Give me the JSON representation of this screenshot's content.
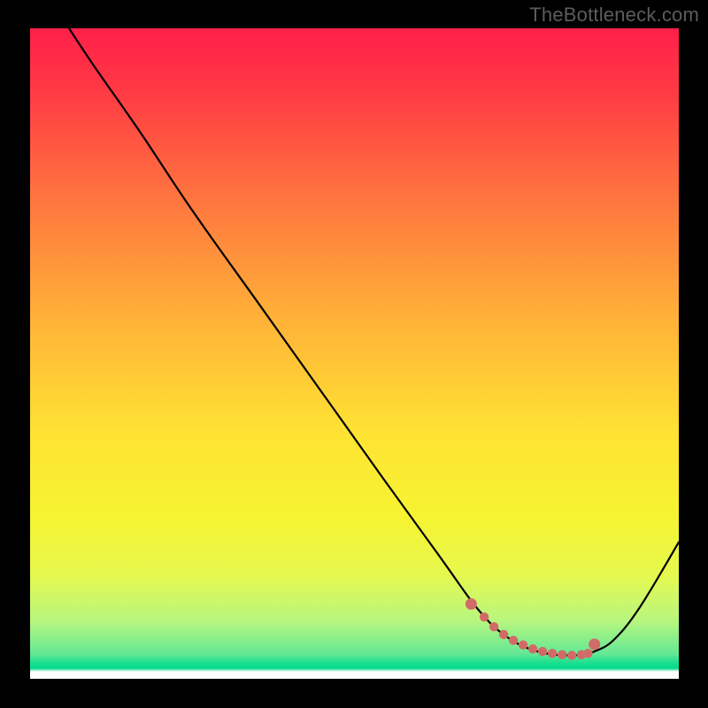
{
  "watermark": "TheBottleneck.com",
  "chart_data": {
    "type": "line",
    "title": "",
    "xlabel": "",
    "ylabel": "",
    "xlim": [
      0,
      100
    ],
    "ylim": [
      0,
      100
    ],
    "grid": false,
    "series": [
      {
        "name": "bottleneck-curve",
        "x": [
          6,
          10,
          17,
          25,
          35,
          45,
          55,
          63,
          68,
          71,
          73,
          75,
          77,
          79,
          81,
          83,
          85,
          87,
          90,
          94,
          100
        ],
        "y": [
          100,
          94,
          84,
          72,
          58,
          44,
          30,
          19,
          12,
          8.5,
          6.8,
          5.5,
          4.6,
          4.0,
          3.7,
          3.6,
          3.7,
          4.2,
          6.0,
          11,
          21
        ]
      }
    ],
    "markers": {
      "name": "highlight-dots",
      "x": [
        68,
        70,
        71.5,
        73,
        74.5,
        76,
        77.5,
        79,
        80.5,
        82,
        83.5,
        85,
        86,
        87
      ],
      "y": [
        11.5,
        9.5,
        8.0,
        6.8,
        5.9,
        5.2,
        4.6,
        4.2,
        3.9,
        3.7,
        3.6,
        3.7,
        3.9,
        5.3
      ]
    },
    "gradient_stops": [
      {
        "pos": 0,
        "color": "#ff1f49"
      },
      {
        "pos": 0.1,
        "color": "#ff3b44"
      },
      {
        "pos": 0.25,
        "color": "#ff713f"
      },
      {
        "pos": 0.45,
        "color": "#ffb338"
      },
      {
        "pos": 0.62,
        "color": "#ffe233"
      },
      {
        "pos": 0.75,
        "color": "#f6f431"
      },
      {
        "pos": 0.84,
        "color": "#e6f84e"
      },
      {
        "pos": 0.91,
        "color": "#b9f67e"
      },
      {
        "pos": 0.962,
        "color": "#63e895"
      },
      {
        "pos": 0.976,
        "color": "#18df8f"
      },
      {
        "pos": 0.984,
        "color": "#05da8b"
      },
      {
        "pos": 0.989,
        "color": "#ffffff"
      },
      {
        "pos": 1.0,
        "color": "#ffffff"
      }
    ]
  }
}
